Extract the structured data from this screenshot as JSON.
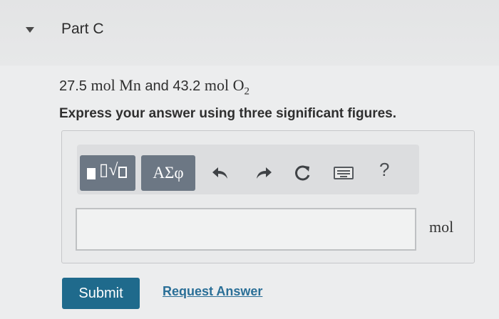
{
  "header": {
    "title": "Part C"
  },
  "question": {
    "amount1": "27.5",
    "unit1": "mol",
    "element1": "Mn",
    "connector": "and",
    "amount2": "43.2",
    "unit2": "mol",
    "element2": "O",
    "element2_subscript": "2"
  },
  "instruction": "Express your answer using three significant figures.",
  "toolbar": {
    "greek_label": "ΑΣφ",
    "templates_fraction": "▯√",
    "help_label": "?",
    "icons": [
      "templates-icon",
      "greek-icon",
      "undo-icon",
      "redo-icon",
      "reset-icon",
      "keyboard-icon",
      "help-icon"
    ]
  },
  "answer": {
    "value": "",
    "unit": "mol"
  },
  "actions": {
    "submit_label": "Submit",
    "request_label": "Request Answer"
  },
  "colors": {
    "submit_bg": "#1f6a8c",
    "link": "#2a6f97",
    "toolbar_button": "#6c7784"
  }
}
